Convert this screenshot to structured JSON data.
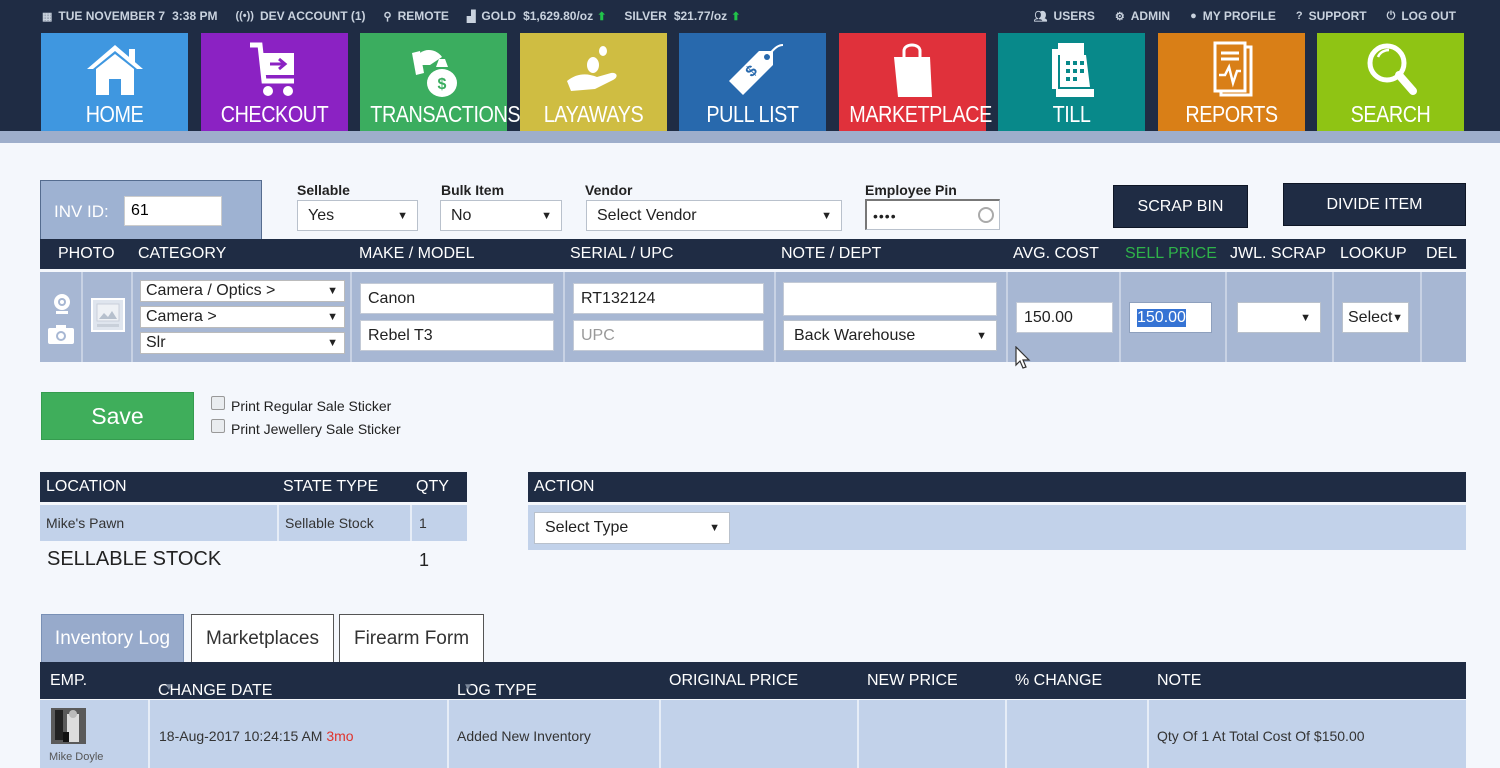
{
  "status_bar": {
    "date": "TUE NOVEMBER 7",
    "time": "3:38 PM",
    "account": "DEV ACCOUNT (1)",
    "location": "REMOTE",
    "gold_label": "GOLD",
    "gold_price": "$1,629.80/oz",
    "silver_label": "SILVER",
    "silver_price": "$21.77/oz",
    "trend_color": "#21c44a",
    "links": [
      "USERS",
      "ADMIN",
      "MY PROFILE",
      "SUPPORT",
      "LOG OUT"
    ]
  },
  "nav_tiles": [
    {
      "label": "HOME",
      "icon": "home-icon",
      "color": "#3f97e0"
    },
    {
      "label": "CHECKOUT",
      "icon": "cart-icon",
      "color": "#8b22c3"
    },
    {
      "label": "TRANSACTIONS",
      "icon": "money-bag-icon",
      "color": "#3bad5f"
    },
    {
      "label": "LAYAWAYS",
      "icon": "hand-coins-icon",
      "color": "#cfbd42"
    },
    {
      "label": "PULL LIST",
      "icon": "price-tag-icon",
      "color": "#2869ad"
    },
    {
      "label": "MARKETPLACE",
      "icon": "shopping-bag-icon",
      "color": "#e0313b"
    },
    {
      "label": "TILL",
      "icon": "cash-register-icon",
      "color": "#08898a"
    },
    {
      "label": "REPORTS",
      "icon": "report-icon",
      "color": "#d97f17"
    },
    {
      "label": "SEARCH",
      "icon": "magnifier-icon",
      "color": "#8fc414"
    }
  ],
  "item": {
    "inv_id_label": "INV ID:",
    "inv_id": "61",
    "sellable_label": "Sellable",
    "sellable": "Yes",
    "bulk_label": "Bulk Item",
    "bulk": "No",
    "vendor_label": "Vendor",
    "vendor": "Select Vendor",
    "pin_label": "Employee Pin",
    "pin_mask": "••••",
    "scrap_bin_label": "SCRAP BIN",
    "divide_item_label": "DIVIDE ITEM"
  },
  "grid": {
    "headers": {
      "photo": "PHOTO",
      "category": "CATEGORY",
      "make_model": "MAKE / MODEL",
      "serial_upc": "SERIAL / UPC",
      "note_dept": "NOTE / DEPT",
      "avg_cost": "AVG. COST",
      "sell_price": "SELL PRICE",
      "jwl_scrap": "JWL. SCRAP",
      "lookup": "LOOKUP",
      "del": "DEL"
    },
    "sell_price_color": "#2fb34a",
    "category_1": "Camera / Optics >",
    "category_2": "Camera >",
    "category_3": "Slr",
    "make": "Canon",
    "model": "Rebel T3",
    "serial": "RT132124",
    "upc_placeholder": "UPC",
    "note": "",
    "dept": "Back Warehouse",
    "avg_cost": "150.00",
    "sell_price": "150.00",
    "jwl_scrap": "",
    "lookup": "Select"
  },
  "save": {
    "label": "Save",
    "print_regular": "Print Regular Sale Sticker",
    "print_jewellery": "Print Jewellery Sale Sticker"
  },
  "locations": {
    "headers": [
      "LOCATION",
      "STATE TYPE",
      "QTY"
    ],
    "rows": [
      {
        "location": "Mike's Pawn",
        "state": "Sellable Stock",
        "qty": "1"
      }
    ],
    "total_label": "SELLABLE STOCK",
    "total_qty": "1"
  },
  "action": {
    "header": "ACTION",
    "select": "Select Type"
  },
  "tabs": [
    {
      "label": "Inventory Log",
      "active": true
    },
    {
      "label": "Marketplaces",
      "active": false
    },
    {
      "label": "Firearm Form",
      "active": false
    }
  ],
  "log": {
    "headers": [
      "EMP.",
      "CHANGE DATE",
      "LOG TYPE",
      "ORIGINAL PRICE",
      "NEW PRICE",
      "% CHANGE",
      "NOTE"
    ],
    "rows": [
      {
        "employee": "Mike Doyle",
        "change_date": "18-Aug-2017 10:24:15 AM",
        "age": "3mo",
        "log_type": "Added New Inventory",
        "original_price": "",
        "new_price": "",
        "pct_change": "",
        "note": "Qty Of 1 At Total Cost Of $150.00"
      }
    ]
  }
}
